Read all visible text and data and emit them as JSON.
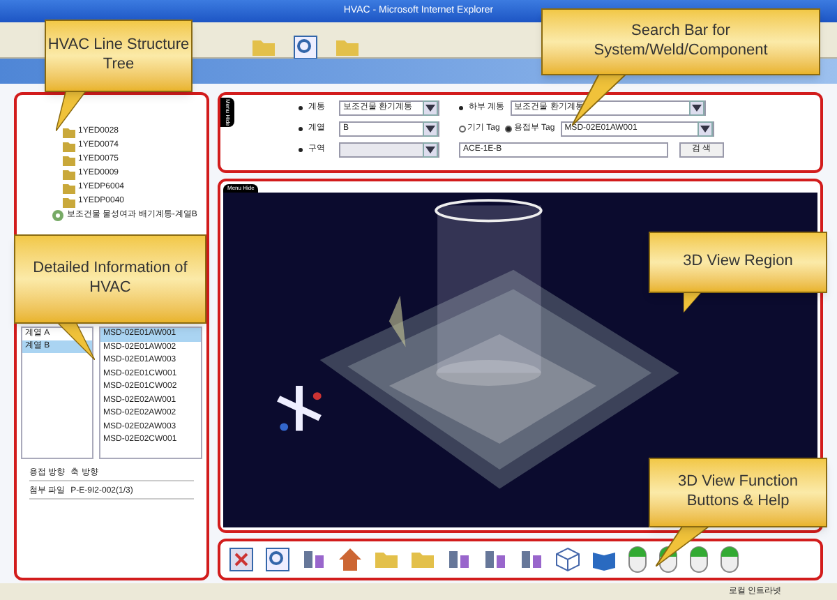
{
  "window": {
    "title": "HVAC - Microsoft Internet Explorer"
  },
  "tree": {
    "items": [
      {
        "label": "1YED0028",
        "kind": "folder"
      },
      {
        "label": "1YED0074",
        "kind": "folder"
      },
      {
        "label": "1YED0075",
        "kind": "folder"
      },
      {
        "label": "1YED0009",
        "kind": "folder"
      },
      {
        "label": "1YEDP6004",
        "kind": "folder"
      },
      {
        "label": "1YEDP0040",
        "kind": "folder"
      },
      {
        "label": "보조건물 물성여과 배기계통-계열B",
        "kind": "system"
      }
    ]
  },
  "detail": {
    "trains": [
      {
        "label": "계열 A",
        "selected": false
      },
      {
        "label": "계열 B",
        "selected": true
      }
    ],
    "tags": [
      {
        "label": "MSD-02E01AW001",
        "selected": true
      },
      {
        "label": "MSD-02E01AW002",
        "selected": false
      },
      {
        "label": "MSD-02E01AW003",
        "selected": false
      },
      {
        "label": "MSD-02E01CW001",
        "selected": false
      },
      {
        "label": "MSD-02E01CW002",
        "selected": false
      },
      {
        "label": "MSD-02E02AW001",
        "selected": false
      },
      {
        "label": "MSD-02E02AW002",
        "selected": false
      },
      {
        "label": "MSD-02E02AW003",
        "selected": false
      },
      {
        "label": "MSD-02E02CW001",
        "selected": false
      }
    ],
    "info": [
      {
        "label": "용접 방향",
        "value": "축 방향"
      },
      {
        "label": "첨부 파일",
        "value": "P-E-9I2-002(1/3)"
      }
    ]
  },
  "search": {
    "tab": "Menu Hide",
    "fields": [
      {
        "label": "계통",
        "value": "보조건물 환기계통",
        "disabled": false
      },
      {
        "label": "계열",
        "value": "B",
        "disabled": false
      },
      {
        "label": "구역",
        "disabled": true
      }
    ],
    "subsystem": {
      "label": "하부 계통",
      "value": "보조건물 환기계통"
    },
    "tag_types": [
      {
        "label": "기기 Tag",
        "selected": false
      },
      {
        "label": "용접부 Tag",
        "selected": true
      }
    ],
    "tag_value": "MSD-02E01AW001",
    "query": "ACE-1E-B",
    "button": "검 색"
  },
  "view": {
    "tab": "Menu Hide"
  },
  "callouts": [
    "HVAC Line Structure Tree",
    "Search Bar for System/Weld/Component",
    "Detailed Information of HVAC",
    "3D View Region",
    "3D View Function Buttons & Help"
  ],
  "status_bar": {
    "zone": "로컬 인트라넷"
  }
}
